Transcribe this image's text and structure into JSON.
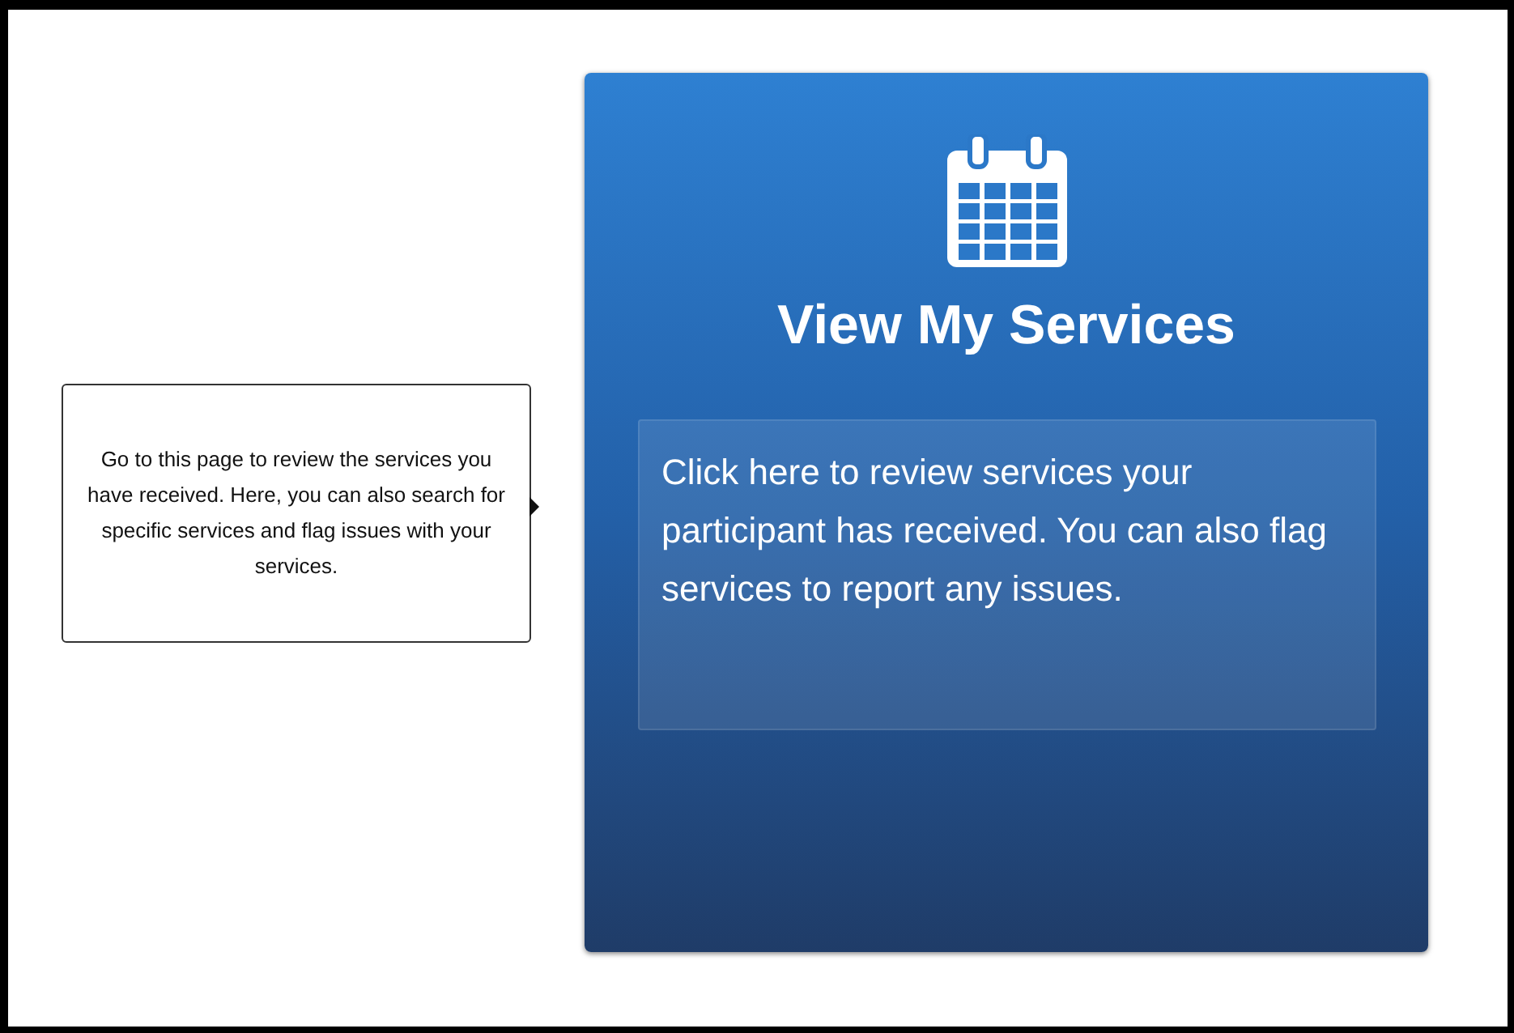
{
  "callout": {
    "text": "Go to this page to review the services you have received. Here, you can also search for specific services and flag issues with your services."
  },
  "card": {
    "title": "View My Services",
    "description": "Click here to review services your participant has received. You can also flag services to report any issues."
  }
}
